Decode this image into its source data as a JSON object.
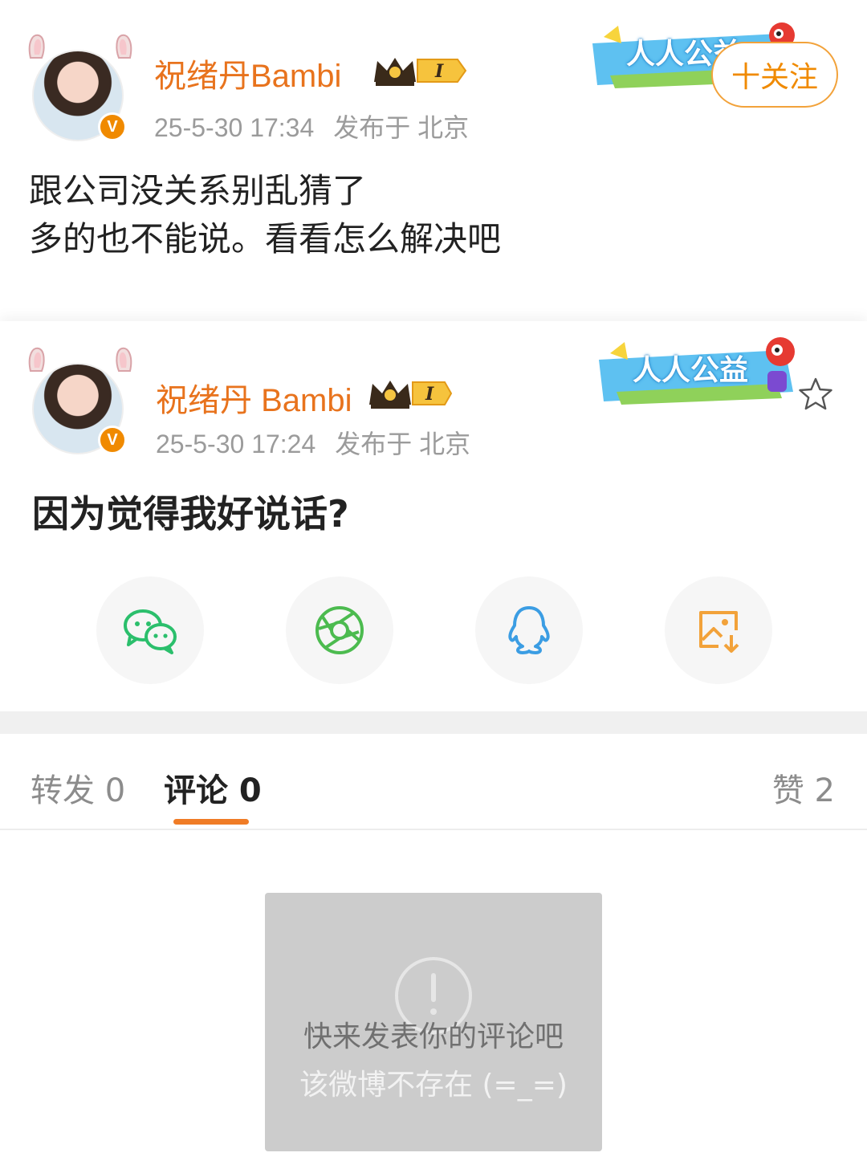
{
  "post_quoted": {
    "username": "祝绪丹Bambi",
    "level_badge": "I",
    "timestamp": "25-5-30 17:34",
    "location": "发布于 北京",
    "banner_text": "人人公益",
    "follow_label": "十关注",
    "text_line1": "跟公司没关系别乱猜了",
    "text_line2": "多的也不能说。看看怎么解决吧",
    "verified_badge": "V"
  },
  "post_main": {
    "username": "祝绪丹 Bambi",
    "level_badge": "I",
    "timestamp": "25-5-30 17:24",
    "location": "发布于 北京",
    "banner_text": "人人公益",
    "text": "因为觉得我好说话?",
    "verified_badge": "V"
  },
  "share": {
    "icons": [
      "wechat-icon",
      "moments-icon",
      "qq-icon",
      "save-image-icon"
    ]
  },
  "tabs": {
    "repost": "转发 0",
    "comments": "评论 0",
    "likes": "赞 2"
  },
  "empty_state": {
    "line1": "快来发表你的评论吧",
    "line2": "该微博不存在 (=_=)"
  },
  "colors": {
    "accent": "#f08a00",
    "username": "#e8731d",
    "tab_underline": "#f07c26",
    "wechat": "#2bbf6c",
    "qq": "#3b9de3"
  }
}
